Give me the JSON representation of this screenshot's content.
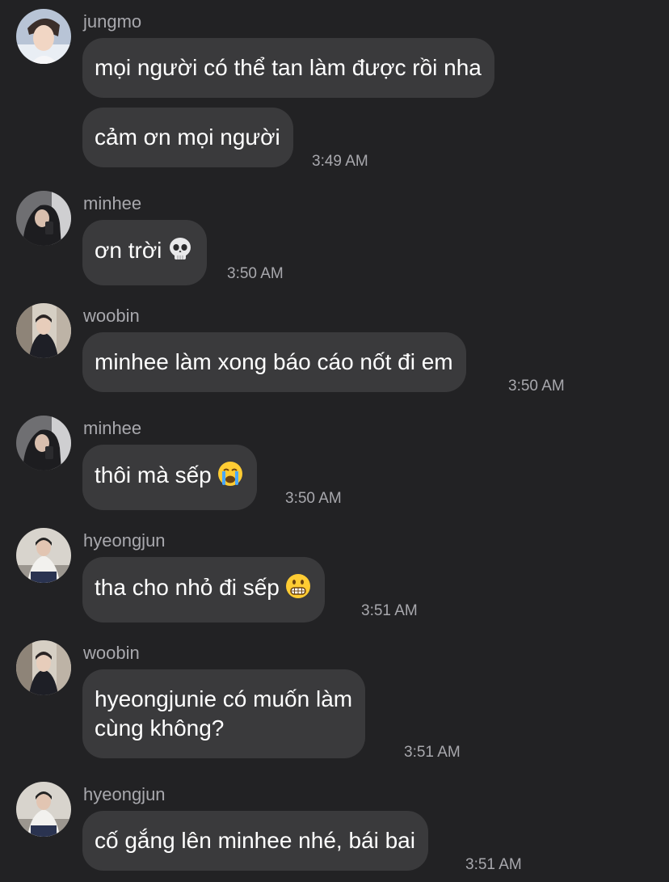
{
  "messages": [
    {
      "sender": "jungmo",
      "avatar": "avatar-jungmo",
      "bubbles": [
        {
          "text": "mọi người có thể tan làm được rồi nha"
        },
        {
          "text": "cảm ơn mọi người",
          "time": "3:49 AM"
        }
      ]
    },
    {
      "sender": "minhee",
      "avatar": "avatar-minhee",
      "bubbles": [
        {
          "text": "ơn trời",
          "emoji": "skull-emoji",
          "time": "3:50 AM"
        }
      ]
    },
    {
      "sender": "woobin",
      "avatar": "avatar-woobin",
      "bubbles": [
        {
          "text": "minhee làm xong báo cáo nốt đi em",
          "time": "3:50 AM"
        }
      ]
    },
    {
      "sender": "minhee",
      "avatar": "avatar-minhee",
      "bubbles": [
        {
          "text": "thôi mà sếp",
          "emoji": "crying-face-emoji",
          "time": "3:50 AM"
        }
      ]
    },
    {
      "sender": "hyeongjun",
      "avatar": "avatar-hyeongjun",
      "bubbles": [
        {
          "text": "tha cho nhỏ đi sếp",
          "emoji": "grimacing-face-emoji",
          "time": "3:51 AM"
        }
      ]
    },
    {
      "sender": "woobin",
      "avatar": "avatar-woobin",
      "bubbles": [
        {
          "text": "hyeongjunie có muốn làm\ncùng không?",
          "time": "3:51 AM"
        }
      ]
    },
    {
      "sender": "hyeongjun",
      "avatar": "avatar-hyeongjun",
      "bubbles": [
        {
          "text": "cố gắng lên minhee nhé, bái bai",
          "time": "3:51 AM"
        }
      ]
    }
  ],
  "colors": {
    "background": "#222224",
    "bubble": "#3a3a3c",
    "meta_text": "#a8a8ad",
    "message_text": "#ffffff"
  }
}
